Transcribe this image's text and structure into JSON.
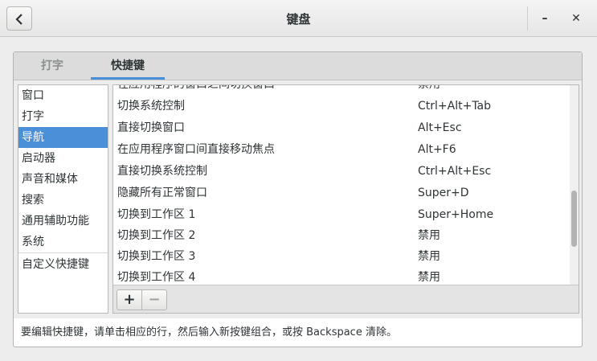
{
  "window": {
    "title": "键盘",
    "minimize_glyph": "–",
    "close_glyph": "✕"
  },
  "tabs": [
    {
      "label": "打字",
      "active": false
    },
    {
      "label": "快捷键",
      "active": true
    }
  ],
  "categories": [
    "窗口",
    "打字",
    "导航",
    "启动器",
    "声音和媒体",
    "搜索",
    "通用辅助功能",
    "系统",
    "自定义快捷键"
  ],
  "selected_category": "导航",
  "shortcuts": [
    {
      "name": "在应用程序的窗口之间切换窗口",
      "accel": "禁用"
    },
    {
      "name": "切换系统控制",
      "accel": "Ctrl+Alt+Tab"
    },
    {
      "name": "直接切换窗口",
      "accel": "Alt+Esc"
    },
    {
      "name": "在应用程序窗口间直接移动焦点",
      "accel": "Alt+F6"
    },
    {
      "name": "直接切换系统控制",
      "accel": "Ctrl+Alt+Esc"
    },
    {
      "name": "隐藏所有正常窗口",
      "accel": "Super+D"
    },
    {
      "name": "切换到工作区 1",
      "accel": "Super+Home"
    },
    {
      "name": "切换到工作区 2",
      "accel": "禁用"
    },
    {
      "name": "切换到工作区 3",
      "accel": "禁用"
    },
    {
      "name": "切换到工作区 4",
      "accel": "禁用"
    }
  ],
  "toolbar": {
    "add_label": "+",
    "remove_label": "−"
  },
  "hint": "要编辑快捷键，请单击相应的行，然后输入新按键组合，或按 Backspace 清除。",
  "colors": {
    "accent": "#4a90d9"
  },
  "icons": {
    "back": "chevron-left-icon"
  }
}
